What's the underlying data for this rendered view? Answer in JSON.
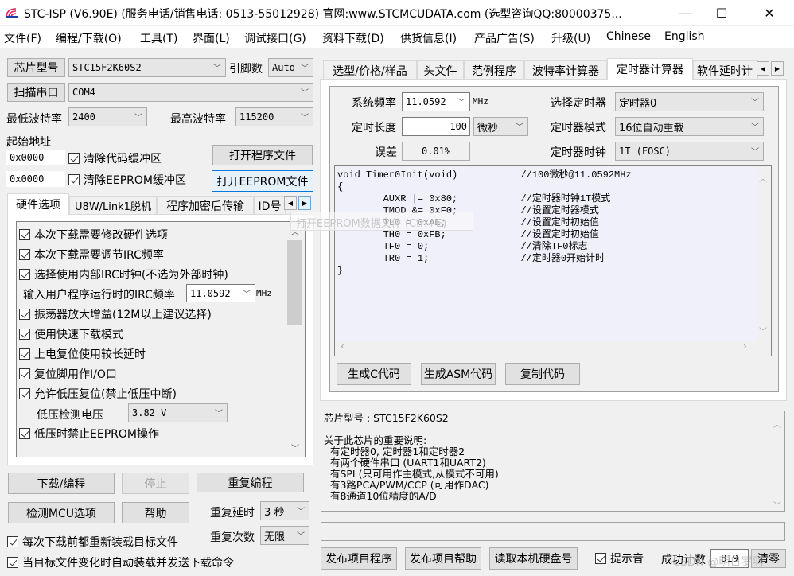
{
  "window": {
    "title": "STC-ISP (V6.90E) (服务电话/销售电话: 0513-55012928) 官网:www.STCMCUDATA.com  (选型咨询QQ:80000375...",
    "minimize": "—",
    "maximize": "☐",
    "close": "✕"
  },
  "menu": [
    "文件(F)",
    "编程/下载(O)",
    "工具(T)",
    "界面(L)",
    "调试接口(G)",
    "资料下载(D)",
    "供货信息(I)",
    "产品广告(S)",
    "升级(U)",
    "Chinese",
    "English"
  ],
  "left": {
    "chip_type_button": "芯片型号",
    "chip_type_value": "STC15F2K60S2",
    "pin_label": "引脚数",
    "pin_value": "Auto",
    "scan_port_button": "扫描串口",
    "port_value": "COM4",
    "min_baud_label": "最低波特率",
    "min_baud_value": "2400",
    "max_baud_label": "最高波特率",
    "max_baud_value": "115200",
    "start_addr_label": "起始地址",
    "code_addr": "0x0000",
    "eeprom_addr": "0x0000",
    "clear_code_buffer": "清除代码缓冲区",
    "clear_eeprom_buffer": "清除EEPROM缓冲区",
    "open_program_file": "打开程序文件",
    "open_eeprom_file": "打开EEPROM文件",
    "tabs": [
      "硬件选项",
      "U8W/Link1脱机",
      "程序加密后传输",
      "ID号"
    ],
    "hw_options": [
      "本次下载需要修改硬件选项",
      "本次下载需要调节IRC频率",
      "选择使用内部IRC时钟(不选为外部时钟)"
    ],
    "irc_freq_label": "输入用户程序运行时的IRC频率",
    "irc_freq_value": "11.0592",
    "irc_freq_unit": "MHz",
    "hw_options2": [
      "振荡器放大增益(12M以上建议选择)",
      "使用快速下载模式",
      "上电复位使用较长延时",
      "复位脚用作I/O口",
      "允许低压复位(禁止低压中断)"
    ],
    "lvd_label": "低压检测电压",
    "lvd_value": "3.82 V",
    "hw_options3": [
      "低压时禁止EEPROM操作"
    ],
    "download_button": "下载/编程",
    "stop_button": "停止",
    "repeat_program_button": "重复编程",
    "detect_mcu_button": "检测MCU选项",
    "help_button": "帮助",
    "repeat_delay_label": "重复延时",
    "repeat_delay_value": "3 秒",
    "repeat_count_label": "重复次数",
    "repeat_count_value": "无限",
    "reload_before_download": "每次下载前都重新装载目标文件",
    "auto_load_on_change": "当目标文件变化时自动装载并发送下载命令"
  },
  "tooltip": "打开EEPROM数据文件 (Ctrl+E)",
  "right": {
    "tabs": [
      "选型/价格/样品",
      "头文件",
      "范例程序",
      "波特率计算器",
      "定时器计算器",
      "软件延时计"
    ],
    "active_tab": "定时器计算器",
    "sys_freq_label": "系统频率",
    "sys_freq_value": "11.0592",
    "sys_freq_unit": "MHz",
    "timer_length_label": "定时长度",
    "timer_length_value": "100",
    "timer_unit_value": "微秒",
    "error_label": "误差",
    "error_value": "0.01%",
    "select_timer_label": "选择定时器",
    "select_timer_value": "定时器0",
    "timer_mode_label": "定时器模式",
    "timer_mode_value": "16位自动重载",
    "timer_clock_label": "定时器时钟",
    "timer_clock_value": "1T  (FOSC)",
    "code_lines": [
      "void Timer0Init(void)           //100微秒@11.0592MHz",
      "{",
      "        AUXR |= 0x80;           //定时器时钟1T模式",
      "        TMOD &= 0xF0;           //设置定时器模式",
      "        TL0 = 0xAE;             //设置定时初始值",
      "        TH0 = 0xFB;             //设置定时初始值",
      "        TF0 = 0;                //清除TF0标志",
      "        TR0 = 1;                //定时器0开始计时",
      "}"
    ],
    "gen_c_button": "生成C代码",
    "gen_asm_button": "生成ASM代码",
    "copy_code_button": "复制代码",
    "info_lines": [
      "芯片型号 : STC15F2K60S2",
      "",
      "关于此芯片的重要说明:",
      "  有定时器0, 定时器1和定时器2",
      "  有两个硬件串口 (UART1和UART2)",
      "  有SPI (只可用作主模式,从模式不可用)",
      "  有3路PCA/PWM/CCP (可用作DAC)",
      "  有8通道10位精度的A/D"
    ],
    "publish_program_button": "发布项目程序",
    "publish_help_button": "发布项目帮助",
    "read_disk_button": "读取本机硬盘号",
    "beep_label": "提示音",
    "success_count_label": "成功计数",
    "success_count_value": "819",
    "clear_button": "清零"
  },
  "watermark": "CSDN @明日罗羽"
}
